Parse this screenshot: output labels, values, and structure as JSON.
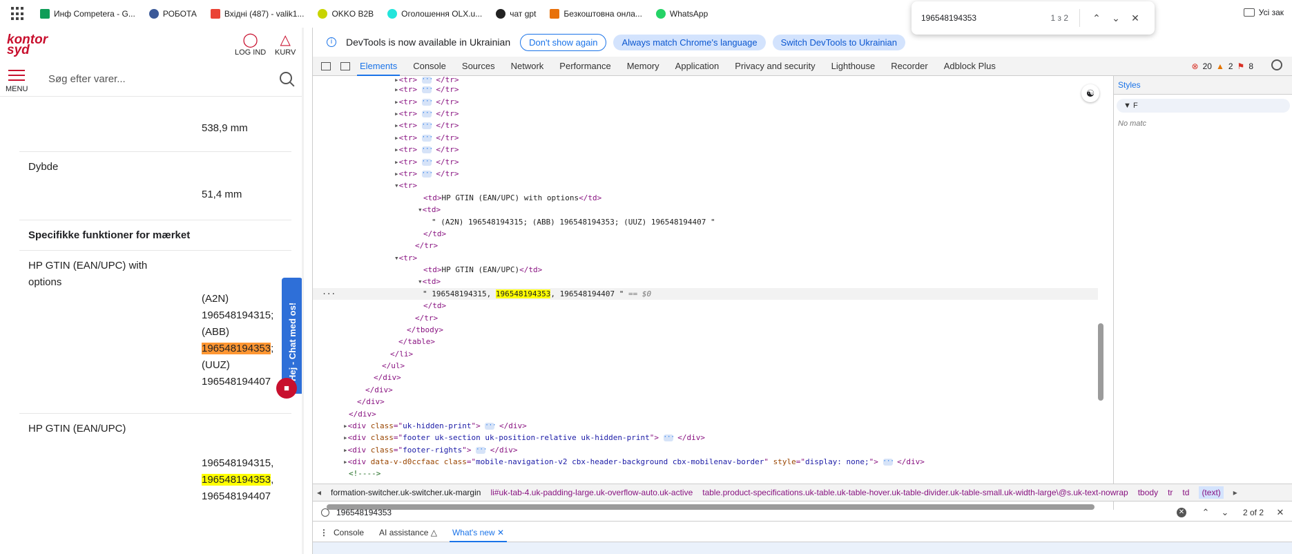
{
  "bookmarks": {
    "items": [
      {
        "label": "Инф Competera - G...",
        "color": "#0f9d58"
      },
      {
        "label": "РОБОТА",
        "color": "#3b5998"
      },
      {
        "label": "Вхідні (487) - valik1...",
        "color": "#ea4335"
      },
      {
        "label": "OKKO B2B",
        "color": "#c8d400"
      },
      {
        "label": "Оголошення OLX.u...",
        "color": "#23e5db"
      },
      {
        "label": "чат gpt",
        "color": "#222222"
      },
      {
        "label": "Безкоштовна онла...",
        "color": "#e8710a"
      },
      {
        "label": "WhatsApp",
        "color": "#25d366"
      }
    ],
    "all_bookmarks": "Усі зак"
  },
  "find": {
    "query": "196548194353",
    "count": "1 з 2"
  },
  "site": {
    "logo_top": "kontor",
    "logo_bottom": "syd",
    "login": "LOG IND",
    "cart": "KURV",
    "menu": "MENU",
    "search_placeholder": "Søg efter varer...",
    "rows": {
      "height_value": "538,9 mm",
      "depth_label": "Dybde",
      "depth_value": "51,4 mm",
      "section_title": "Specifikke funktioner for mærket",
      "gtin_opts_label_1": "HP GTIN (EAN/UPC) with",
      "gtin_opts_label_2": "options",
      "opt1": "(A2N)",
      "opt1_val": "196548194315;",
      "opt2": "(ABB)",
      "opt2_val": "196548194353",
      "opt2_sep": ";",
      "opt3": "(UUZ)",
      "opt3_val": "196548194407",
      "gtin_label": "HP GTIN (EAN/UPC)",
      "gtin_v1": "196548194315,",
      "gtin_v2": "196548194353",
      "gtin_v2_sep": ",",
      "gtin_v3": "196548194407"
    },
    "chat_tab": "Hej - Chat med os!"
  },
  "devtools": {
    "info": {
      "text": "DevTools is now available in Ukrainian",
      "dont_show": "Don't show again",
      "always_match": "Always match Chrome's language",
      "switch": "Switch DevTools to Ukrainian"
    },
    "tabs": [
      "Elements",
      "Console",
      "Sources",
      "Network",
      "Performance",
      "Memory",
      "Application",
      "Privacy and security",
      "Lighthouse",
      "Recorder",
      "Adblock Plus"
    ],
    "badges": {
      "errors": "20",
      "warnings": "2",
      "issues": "8"
    },
    "dom": {
      "td_gtin_opts": "HP GTIN (EAN/UPC) with options",
      "text_opts": "\" (A2N) 196548194315; (ABB) 196548194353; (UUZ) 196548194407 \"",
      "td_gtin": "HP GTIN (EAN/UPC)",
      "text_gtin_pre": "\" 196548194315, ",
      "text_gtin_hl": "196548194353",
      "text_gtin_post": ", 196548194407 \"",
      "eq0": "== $0",
      "cls_hidden_print": "uk-hidden-print",
      "cls_footer": "footer uk-section uk-position-relative uk-hidden-print",
      "cls_footer_rights": "footer-rights",
      "attr_vdata": "data-v-d0ccfaac",
      "cls_mobile_nav": "mobile-navigation-v2 cbx-header-background cbx-mobilenav-border",
      "style_none": "display: none;",
      "comment": "<!---->"
    },
    "styles": {
      "tab": "Styles",
      "filter": "F",
      "no_match": "No matc"
    },
    "breadcrumb": [
      "formation-switcher.uk-switcher.uk-margin",
      "li#uk-tab-4.uk-padding-large.uk-overflow-auto.uk-active",
      "table.product-specifications.uk-table.uk-table-hover.uk-table-divider.uk-table-small.uk-width-large\\@s.uk-text-nowrap",
      "tbody",
      "tr",
      "td",
      "(text)"
    ],
    "search": {
      "query": "196548194353",
      "count": "2 of 2"
    },
    "drawer": {
      "console": "Console",
      "ai": "AI assistance",
      "whats_new": "What's new"
    }
  }
}
